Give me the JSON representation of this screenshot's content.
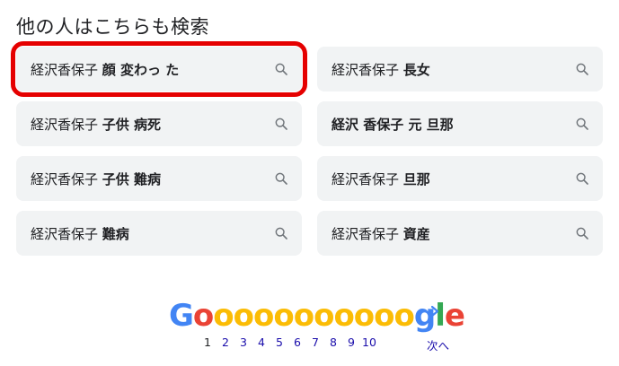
{
  "section_title": "他の人はこちらも検索",
  "suggestions": [
    {
      "plain": "経沢香保子 ",
      "bold": "顔 変わっ た"
    },
    {
      "plain": "経沢香保子 ",
      "bold": "長女"
    },
    {
      "plain": "経沢香保子 ",
      "bold": "子供 病死"
    },
    {
      "plain": "",
      "bold": "経沢 香保子 元 旦那"
    },
    {
      "plain": "経沢香保子 ",
      "bold": "子供 難病"
    },
    {
      "plain": "経沢香保子 ",
      "bold": "旦那"
    },
    {
      "plain": "経沢香保子 ",
      "bold": "難病"
    },
    {
      "plain": "経沢香保子 ",
      "bold": "資産"
    }
  ],
  "highlighted_index": 0,
  "icons": {
    "suggestion": "search-icon",
    "next": "chevron-right-icon"
  },
  "pagination": {
    "logo_letters": [
      {
        "ch": "G",
        "color": "#4285f4"
      },
      {
        "ch": "o",
        "color": "#ea4335"
      },
      {
        "ch": "o",
        "color": "#fbbc05"
      },
      {
        "ch": "o",
        "color": "#fbbc05"
      },
      {
        "ch": "o",
        "color": "#fbbc05"
      },
      {
        "ch": "o",
        "color": "#fbbc05"
      },
      {
        "ch": "o",
        "color": "#fbbc05"
      },
      {
        "ch": "o",
        "color": "#fbbc05"
      },
      {
        "ch": "o",
        "color": "#fbbc05"
      },
      {
        "ch": "o",
        "color": "#fbbc05"
      },
      {
        "ch": "o",
        "color": "#fbbc05"
      },
      {
        "ch": "o",
        "color": "#fbbc05"
      },
      {
        "ch": "g",
        "color": "#4285f4"
      },
      {
        "ch": "l",
        "color": "#34a853"
      },
      {
        "ch": "e",
        "color": "#ea4335"
      }
    ],
    "pages": [
      "1",
      "2",
      "3",
      "4",
      "5",
      "6",
      "7",
      "8",
      "9",
      "10"
    ],
    "current_page": "1",
    "next_label": "次へ"
  },
  "colors": {
    "highlight": "#e50000",
    "link": "#1a0dab",
    "chip_bg": "#f1f3f4"
  }
}
